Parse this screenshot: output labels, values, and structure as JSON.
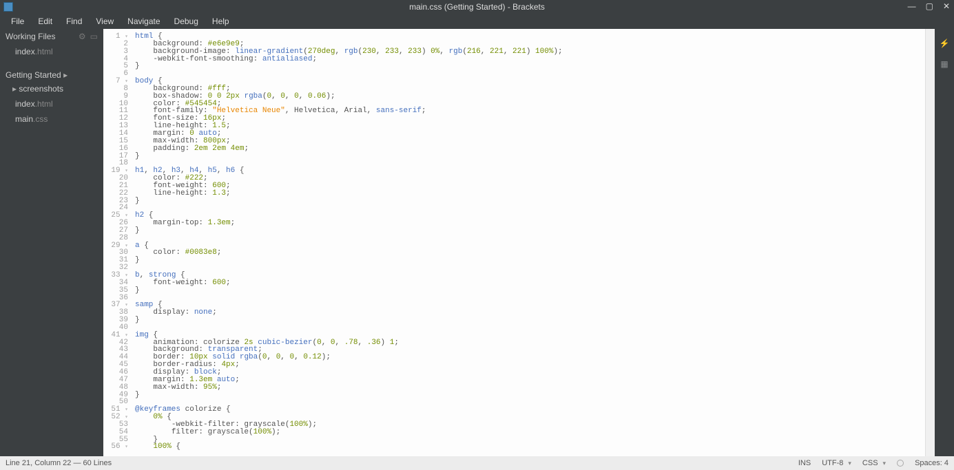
{
  "window": {
    "title": "main.css (Getting Started) - Brackets"
  },
  "menu": {
    "items": [
      "File",
      "Edit",
      "Find",
      "View",
      "Navigate",
      "Debug",
      "Help"
    ]
  },
  "sidebar": {
    "working_files_label": "Working Files",
    "working_files": [
      {
        "name": "index",
        "ext": ".html"
      }
    ],
    "project_label": "Getting Started",
    "project_chevron": "▸",
    "tree": [
      {
        "name": "screenshots",
        "type": "folder",
        "expanded": false
      },
      {
        "name": "index",
        "ext": ".html",
        "type": "file",
        "active": false
      },
      {
        "name": "main",
        "ext": ".css",
        "type": "file",
        "active": true
      }
    ]
  },
  "editor": {
    "line_count": 56,
    "fold_lines": [
      1,
      7,
      19,
      25,
      29,
      33,
      37,
      41,
      51,
      52,
      56
    ],
    "lines": [
      [
        [
          "sel",
          "html"
        ],
        [
          "",
          " {"
        ]
      ],
      [
        [
          "",
          "    "
        ],
        [
          "prop",
          "background"
        ],
        [
          "",
          ": "
        ],
        [
          "atom",
          "#e6e9e9"
        ],
        [
          "",
          ";"
        ]
      ],
      [
        [
          "",
          "    "
        ],
        [
          "prop",
          "background-image"
        ],
        [
          "",
          ": "
        ],
        [
          "kw",
          "linear-gradient"
        ],
        [
          "",
          "("
        ],
        [
          "num",
          "270deg"
        ],
        [
          "",
          ", "
        ],
        [
          "kw",
          "rgb"
        ],
        [
          "",
          "("
        ],
        [
          "num",
          "230"
        ],
        [
          "",
          ", "
        ],
        [
          "num",
          "233"
        ],
        [
          "",
          ", "
        ],
        [
          "num",
          "233"
        ],
        [
          "",
          ") "
        ],
        [
          "num",
          "0%"
        ],
        [
          "",
          ", "
        ],
        [
          "kw",
          "rgb"
        ],
        [
          "",
          "("
        ],
        [
          "num",
          "216"
        ],
        [
          "",
          ", "
        ],
        [
          "num",
          "221"
        ],
        [
          "",
          ", "
        ],
        [
          "num",
          "221"
        ],
        [
          "",
          ") "
        ],
        [
          "num",
          "100%"
        ],
        [
          "",
          ");"
        ]
      ],
      [
        [
          "",
          "    "
        ],
        [
          "prop",
          "-webkit-font-smoothing"
        ],
        [
          "",
          ": "
        ],
        [
          "kw",
          "antialiased"
        ],
        [
          "",
          ";"
        ]
      ],
      [
        [
          "",
          "}"
        ]
      ],
      [
        [
          "",
          ""
        ]
      ],
      [
        [
          "sel",
          "body"
        ],
        [
          "",
          " {"
        ]
      ],
      [
        [
          "",
          "    "
        ],
        [
          "prop",
          "background"
        ],
        [
          "",
          ": "
        ],
        [
          "atom",
          "#fff"
        ],
        [
          "",
          ";"
        ]
      ],
      [
        [
          "",
          "    "
        ],
        [
          "prop",
          "box-shadow"
        ],
        [
          "",
          ": "
        ],
        [
          "num",
          "0"
        ],
        [
          "",
          " "
        ],
        [
          "num",
          "0"
        ],
        [
          "",
          " "
        ],
        [
          "num",
          "2px"
        ],
        [
          "",
          " "
        ],
        [
          "kw",
          "rgba"
        ],
        [
          "",
          "("
        ],
        [
          "num",
          "0"
        ],
        [
          "",
          ", "
        ],
        [
          "num",
          "0"
        ],
        [
          "",
          ", "
        ],
        [
          "num",
          "0"
        ],
        [
          "",
          ", "
        ],
        [
          "num",
          "0.06"
        ],
        [
          "",
          ");"
        ]
      ],
      [
        [
          "",
          "    "
        ],
        [
          "prop",
          "color"
        ],
        [
          "",
          ": "
        ],
        [
          "atom",
          "#545454"
        ],
        [
          "",
          ";"
        ]
      ],
      [
        [
          "",
          "    "
        ],
        [
          "prop",
          "font-family"
        ],
        [
          "",
          ": "
        ],
        [
          "str",
          "\"Helvetica Neue\""
        ],
        [
          "",
          ", Helvetica, Arial, "
        ],
        [
          "kw",
          "sans-serif"
        ],
        [
          "",
          ";"
        ]
      ],
      [
        [
          "",
          "    "
        ],
        [
          "prop",
          "font-size"
        ],
        [
          "",
          ": "
        ],
        [
          "num",
          "16px"
        ],
        [
          "",
          ";"
        ]
      ],
      [
        [
          "",
          "    "
        ],
        [
          "prop",
          "line-height"
        ],
        [
          "",
          ": "
        ],
        [
          "num",
          "1.5"
        ],
        [
          "",
          ";"
        ]
      ],
      [
        [
          "",
          "    "
        ],
        [
          "prop",
          "margin"
        ],
        [
          "",
          ": "
        ],
        [
          "num",
          "0"
        ],
        [
          "",
          " "
        ],
        [
          "kw",
          "auto"
        ],
        [
          "",
          ";"
        ]
      ],
      [
        [
          "",
          "    "
        ],
        [
          "prop",
          "max-width"
        ],
        [
          "",
          ": "
        ],
        [
          "num",
          "800px"
        ],
        [
          "",
          ";"
        ]
      ],
      [
        [
          "",
          "    "
        ],
        [
          "prop",
          "padding"
        ],
        [
          "",
          ": "
        ],
        [
          "num",
          "2em"
        ],
        [
          "",
          " "
        ],
        [
          "num",
          "2em"
        ],
        [
          "",
          " "
        ],
        [
          "num",
          "4em"
        ],
        [
          "",
          ";"
        ]
      ],
      [
        [
          "",
          "}"
        ]
      ],
      [
        [
          "",
          ""
        ]
      ],
      [
        [
          "sel",
          "h1"
        ],
        [
          "",
          ", "
        ],
        [
          "sel",
          "h2"
        ],
        [
          "",
          ", "
        ],
        [
          "sel",
          "h3"
        ],
        [
          "",
          ", "
        ],
        [
          "sel",
          "h4"
        ],
        [
          "",
          ", "
        ],
        [
          "sel",
          "h5"
        ],
        [
          "",
          ", "
        ],
        [
          "sel",
          "h6"
        ],
        [
          "",
          " {"
        ]
      ],
      [
        [
          "",
          "    "
        ],
        [
          "prop",
          "color"
        ],
        [
          "",
          ": "
        ],
        [
          "atom",
          "#222"
        ],
        [
          "",
          ";"
        ]
      ],
      [
        [
          "",
          "    "
        ],
        [
          "prop",
          "font-weight"
        ],
        [
          "",
          ": "
        ],
        [
          "num",
          "600"
        ],
        [
          "",
          ";"
        ]
      ],
      [
        [
          "",
          "    "
        ],
        [
          "prop",
          "line-height"
        ],
        [
          "",
          ": "
        ],
        [
          "num",
          "1.3"
        ],
        [
          "",
          ";"
        ]
      ],
      [
        [
          "",
          "}"
        ]
      ],
      [
        [
          "",
          ""
        ]
      ],
      [
        [
          "sel",
          "h2"
        ],
        [
          "",
          " {"
        ]
      ],
      [
        [
          "",
          "    "
        ],
        [
          "prop",
          "margin-top"
        ],
        [
          "",
          ": "
        ],
        [
          "num",
          "1.3em"
        ],
        [
          "",
          ";"
        ]
      ],
      [
        [
          "",
          "}"
        ]
      ],
      [
        [
          "",
          ""
        ]
      ],
      [
        [
          "sel",
          "a"
        ],
        [
          "",
          " {"
        ]
      ],
      [
        [
          "",
          "    "
        ],
        [
          "prop",
          "color"
        ],
        [
          "",
          ": "
        ],
        [
          "atom",
          "#0083e8"
        ],
        [
          "",
          ";"
        ]
      ],
      [
        [
          "",
          "}"
        ]
      ],
      [
        [
          "",
          ""
        ]
      ],
      [
        [
          "sel",
          "b"
        ],
        [
          "",
          ", "
        ],
        [
          "sel",
          "strong"
        ],
        [
          "",
          " {"
        ]
      ],
      [
        [
          "",
          "    "
        ],
        [
          "prop",
          "font-weight"
        ],
        [
          "",
          ": "
        ],
        [
          "num",
          "600"
        ],
        [
          "",
          ";"
        ]
      ],
      [
        [
          "",
          "}"
        ]
      ],
      [
        [
          "",
          ""
        ]
      ],
      [
        [
          "sel",
          "samp"
        ],
        [
          "",
          " {"
        ]
      ],
      [
        [
          "",
          "    "
        ],
        [
          "prop",
          "display"
        ],
        [
          "",
          ": "
        ],
        [
          "kw",
          "none"
        ],
        [
          "",
          ";"
        ]
      ],
      [
        [
          "",
          "}"
        ]
      ],
      [
        [
          "",
          ""
        ]
      ],
      [
        [
          "sel",
          "img"
        ],
        [
          "",
          " {"
        ]
      ],
      [
        [
          "",
          "    "
        ],
        [
          "prop",
          "animation"
        ],
        [
          "",
          ": colorize "
        ],
        [
          "num",
          "2s"
        ],
        [
          "",
          " "
        ],
        [
          "kw",
          "cubic-bezier"
        ],
        [
          "",
          "("
        ],
        [
          "num",
          "0"
        ],
        [
          "",
          ", "
        ],
        [
          "num",
          "0"
        ],
        [
          "",
          ", "
        ],
        [
          "num",
          ".78"
        ],
        [
          "",
          ", "
        ],
        [
          "num",
          ".36"
        ],
        [
          "",
          ") "
        ],
        [
          "num",
          "1"
        ],
        [
          "",
          ";"
        ]
      ],
      [
        [
          "",
          "    "
        ],
        [
          "prop",
          "background"
        ],
        [
          "",
          ": "
        ],
        [
          "kw",
          "transparent"
        ],
        [
          "",
          ";"
        ]
      ],
      [
        [
          "",
          "    "
        ],
        [
          "prop",
          "border"
        ],
        [
          "",
          ": "
        ],
        [
          "num",
          "10px"
        ],
        [
          "",
          " "
        ],
        [
          "kw",
          "solid"
        ],
        [
          "",
          " "
        ],
        [
          "kw",
          "rgba"
        ],
        [
          "",
          "("
        ],
        [
          "num",
          "0"
        ],
        [
          "",
          ", "
        ],
        [
          "num",
          "0"
        ],
        [
          "",
          ", "
        ],
        [
          "num",
          "0"
        ],
        [
          "",
          ", "
        ],
        [
          "num",
          "0.12"
        ],
        [
          "",
          ");"
        ]
      ],
      [
        [
          "",
          "    "
        ],
        [
          "prop",
          "border-radius"
        ],
        [
          "",
          ": "
        ],
        [
          "num",
          "4px"
        ],
        [
          "",
          ";"
        ]
      ],
      [
        [
          "",
          "    "
        ],
        [
          "prop",
          "display"
        ],
        [
          "",
          ": "
        ],
        [
          "kw",
          "block"
        ],
        [
          "",
          ";"
        ]
      ],
      [
        [
          "",
          "    "
        ],
        [
          "prop",
          "margin"
        ],
        [
          "",
          ": "
        ],
        [
          "num",
          "1.3em"
        ],
        [
          "",
          " "
        ],
        [
          "kw",
          "auto"
        ],
        [
          "",
          ";"
        ]
      ],
      [
        [
          "",
          "    "
        ],
        [
          "prop",
          "max-width"
        ],
        [
          "",
          ": "
        ],
        [
          "num",
          "95%"
        ],
        [
          "",
          ";"
        ]
      ],
      [
        [
          "",
          "}"
        ]
      ],
      [
        [
          "",
          ""
        ]
      ],
      [
        [
          "sel",
          "@keyframes"
        ],
        [
          "",
          " colorize {"
        ]
      ],
      [
        [
          "",
          "    "
        ],
        [
          "num",
          "0%"
        ],
        [
          "",
          " {"
        ]
      ],
      [
        [
          "",
          "        "
        ],
        [
          "prop",
          "-webkit-filter"
        ],
        [
          "",
          ": grayscale("
        ],
        [
          "num",
          "100%"
        ],
        [
          "",
          ");"
        ]
      ],
      [
        [
          "",
          "        "
        ],
        [
          "prop",
          "filter"
        ],
        [
          "",
          ": grayscale("
        ],
        [
          "num",
          "100%"
        ],
        [
          "",
          ");"
        ]
      ],
      [
        [
          "",
          "    }"
        ]
      ],
      [
        [
          "",
          "    "
        ],
        [
          "num",
          "100%"
        ],
        [
          "",
          " {"
        ]
      ]
    ]
  },
  "status": {
    "cursor": "Line 21, Column 22 — 60 Lines",
    "ins": "INS",
    "encoding": "UTF-8",
    "lang": "CSS",
    "spaces": "Spaces: 4"
  }
}
